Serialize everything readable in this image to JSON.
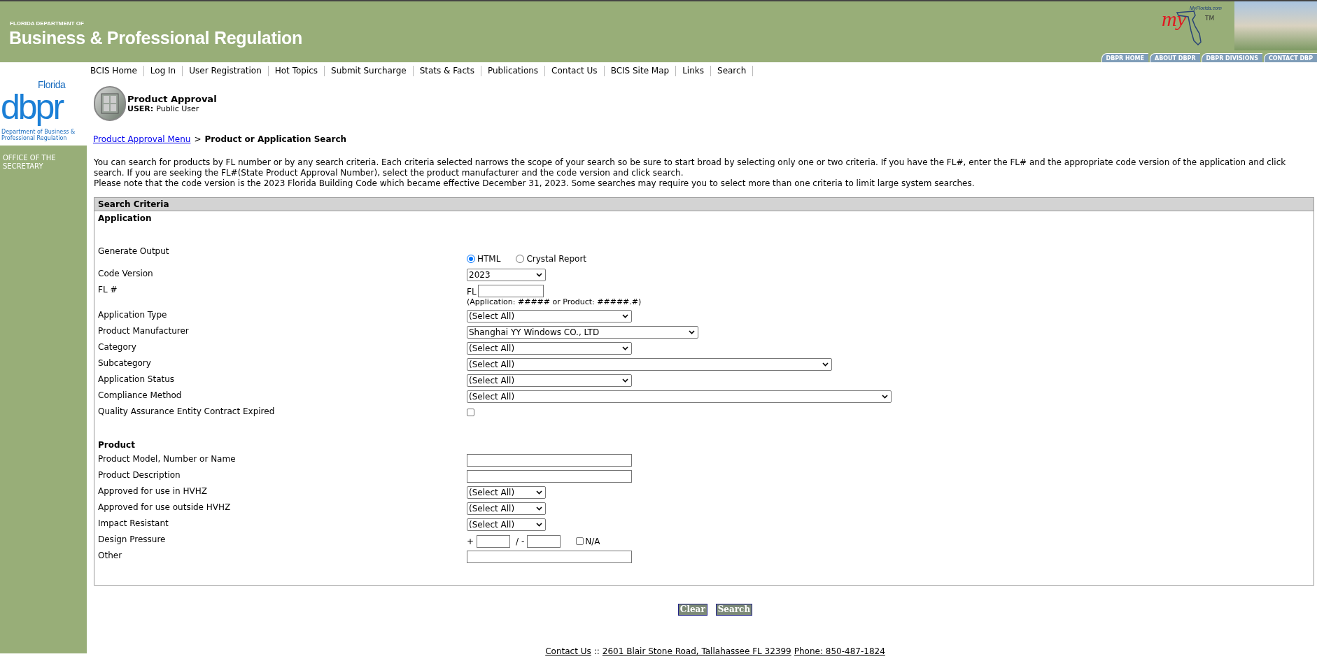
{
  "header": {
    "agency_small": "FLORIDA DEPARTMENT OF",
    "agency_name": "Business & Professional Regulation",
    "myflorida_site": "MyFlorida.com",
    "myflorida_mark": "my",
    "trademark": "TM",
    "tabs": [
      {
        "label": "DBPR HOME"
      },
      {
        "label": "ABOUT DBPR"
      },
      {
        "label": "DBPR DIVISIONS"
      },
      {
        "label": "CONTACT DBP"
      }
    ]
  },
  "nav": [
    "BCIS Home",
    "Log In",
    "User Registration",
    "Hot Topics",
    "Submit Surcharge",
    "Stats & Facts",
    "Publications",
    "Contact Us",
    "BCIS Site Map",
    "Links",
    "Search"
  ],
  "logo": {
    "state": "Florida",
    "letters": "dbpr",
    "caption": "Department of Business & Professional Regulation"
  },
  "sidebar": {
    "items": [
      "OFFICE OF THE SECRETARY"
    ]
  },
  "app": {
    "title": "Product Approval",
    "user_label": "USER:",
    "user": "Public User"
  },
  "breadcrumb": {
    "link": "Product Approval Menu",
    "separator": ">",
    "current": "Product or Application Search"
  },
  "intro": [
    "You can search for products by FL number or by any search criteria. Each criteria selected narrows the scope of your search so be sure to start broad by selecting only one or two criteria. If you have the FL#, enter the FL# and the appropriate code version of the application and click search. If you are seeking the FL#(State Product Approval Number), select the product manufacturer and the code version and click search.",
    "Please note that the code version is the 2023 Florida Building Code which became effective December 31, 2023. Some searches may require you to select more than one criteria to limit large system searches."
  ],
  "form": {
    "title": "Search Criteria",
    "sections": [
      {
        "title": "Application",
        "fields": [
          {
            "label": "Generate Output",
            "kind": "radio",
            "options": [
              {
                "label": "HTML",
                "selected": true
              },
              {
                "label": "Crystal Report",
                "selected": false
              }
            ]
          },
          {
            "label": "Code Version",
            "kind": "select",
            "value": "2023"
          },
          {
            "label": "FL #",
            "kind": "fl",
            "prefix": "FL",
            "hint": "(Application: ##### or Product: #####.#)"
          },
          {
            "label": "Application Type",
            "kind": "select",
            "value": "(Select All)"
          },
          {
            "label": "Product Manufacturer",
            "kind": "select",
            "value": "Shanghai YY Windows CO., LTD"
          },
          {
            "label": "Category",
            "kind": "select",
            "value": "(Select All)"
          },
          {
            "label": "Subcategory",
            "kind": "select",
            "value": "(Select All)"
          },
          {
            "label": "Application Status",
            "kind": "select",
            "value": "(Select All)"
          },
          {
            "label": "Compliance Method",
            "kind": "select",
            "value": "(Select All)"
          },
          {
            "label": "Quality Assurance Entity Contract Expired",
            "kind": "checkbox",
            "checked": false
          }
        ]
      },
      {
        "title": "Product",
        "fields": [
          {
            "label": "Product Model, Number or Name",
            "kind": "text"
          },
          {
            "label": "Product Description",
            "kind": "text"
          },
          {
            "label": "Approved for use in HVHZ",
            "kind": "select",
            "value": "(Select All)"
          },
          {
            "label": "Approved for use outside HVHZ",
            "kind": "select",
            "value": "(Select All)"
          },
          {
            "label": "Impact Resistant",
            "kind": "select",
            "value": "(Select All)"
          },
          {
            "label": "Design Pressure",
            "kind": "pressure",
            "plus": "+",
            "minus": "/ -",
            "na_label": "N/A",
            "na_checked": false
          },
          {
            "label": "Other",
            "kind": "text"
          }
        ]
      }
    ]
  },
  "buttons": [
    "Clear",
    "Search"
  ],
  "footer": {
    "contact": "Contact Us",
    "separator": "::",
    "address": "2601 Blair Stone Road, Tallahassee FL 32399",
    "phone": "Phone: 850-487-1824"
  }
}
